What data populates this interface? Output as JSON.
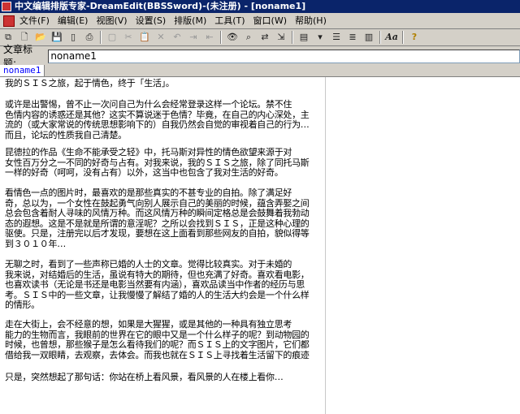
{
  "window": {
    "title": "中文编辑排版专家-DreamEdit(BBSSword)-(未注册) - [noname1]"
  },
  "menu": [
    "文件(F)",
    "编辑(E)",
    "视图(V)",
    "设置(S)",
    "排版(M)",
    "工具(T)",
    "窗口(W)",
    "帮助(H)"
  ],
  "title_field": {
    "label": "文章标题:",
    "value": "noname1"
  },
  "tab": {
    "label": "noname1"
  },
  "document": {
    "paragraphs": [
      [
        "    我的ＳＩＳ之旅，起于情色，终于「生活」。"
      ],
      [
        "    或许是出警惕，曾不止一次问自己为什么会经常登录这样一个论坛。禁不住",
        "色情内容的诱惑还是其他？这实不算说迷于色情？毕竟，在自己的内心深处，主",
        "流的（或大家常说的传统思想影响下的）自我仍然会自觉的审视着自己的行为…",
        "而且，论坛的性质我自己清楚。"
      ],
      [
        "    昆德拉的作品《生命不能承受之轻》中，托马斯对异性的情色欲望来源于对",
        "女性百万分之一不同的好奇与占有。对我来说，我的ＳＩＳ之旅，除了同托马斯",
        "一样的好奇（呵呵，没有占有）以外，这当中也包含了我对生活的好奇。"
      ],
      [
        "    看情色一点的图片时，最喜欢的是那些真实的不甚专业的自拍。除了满足好",
        "奇，总以为，一个女性在鼓起勇气向别人展示自己的美丽的时候，蕴含弄娶之间",
        "总会包含着耐人寻味的风情万种。而这风情万种的瞬间定格总是会鼓舞着我勃动",
        "态的遐想。这是不是就是所谓的意淫呢？之所以会找到ＳＩＳ，正是这种心理的",
        "驱使。只是，注册完以后才发现，要想在这上面看到那些网友的自拍，貌似得等",
        "到３０１０年…"
      ],
      [
        "    无聊之时，看到了一些声称已婚的人士的文章。觉得比较真实。对于未婚的",
        "我来说，对结婚后的生活，虽说有特大的期待，但也充满了好奇。喜欢看电影，",
        "也喜欢读书（无论是书还是电影当然要有内涵），喜欢品读当中作者的经历与思",
        "考。ＳＩＳ中的一些文章，让我慢慢了解结了婚的人的生活大约会是一个什么样",
        "的情形。"
      ],
      [
        "    走在大街上，会不经意的想，如果是大猩猩，或是其他的一种具有独立思考",
        "能力的生物而言，我眼前的世界在它的眼中又是一个什么样子的呢？到动物园的",
        "时候，也曾想，那些猴子是怎么看待我们的呢？而ＳＩＳ上的文字图片，它们都",
        "借给我一双眼睛，去观察，去体会。而我也就在ＳＩＳ上寻找着生活留下的痕迹"
      ],
      [
        "    只是，突然想起了那句话：你站在桥上看风景，看风景的人在楼上看你…"
      ]
    ]
  }
}
